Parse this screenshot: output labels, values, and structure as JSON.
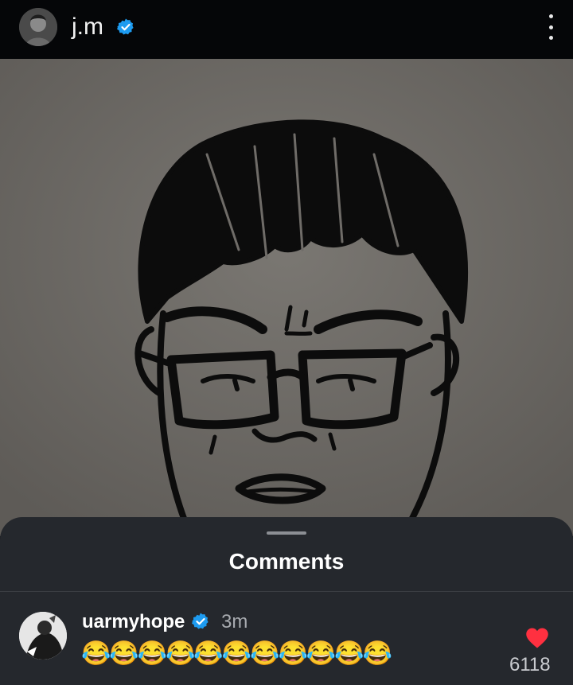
{
  "header": {
    "username": "j.m",
    "verified": true,
    "more_icon": "more-vertical-icon"
  },
  "post": {
    "image": "line drawing of a face with glasses"
  },
  "comments_sheet": {
    "title": "Comments",
    "comments": [
      {
        "username": "uarmyhope",
        "verified": true,
        "time": "3m",
        "text": "😂😂😂😂😂😂😂😂😂😂😂",
        "likes": "6118",
        "liked": true
      }
    ]
  },
  "colors": {
    "background": "#050608",
    "sheet": "#25282d",
    "verified_blue": "#1d9bf0",
    "heart_red": "#ff3040"
  }
}
